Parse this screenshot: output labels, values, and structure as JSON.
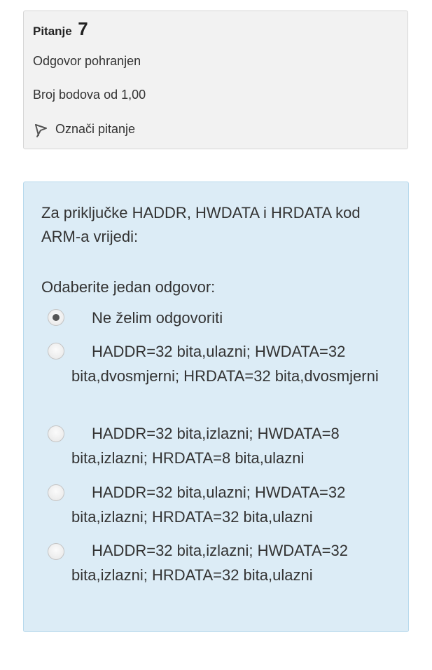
{
  "info": {
    "question_label": "Pitanje",
    "question_number": "7",
    "state": "Odgovor pohranjen",
    "grade": "Broj bodova od 1,00",
    "flag_label": "Označi pitanje"
  },
  "question": {
    "text": "Za priključke HADDR, HWDATA i HRDATA kod ARM-a vrijedi:",
    "prompt": "Odaberite jedan odgovor:",
    "options": [
      {
        "label": "Ne želim odgovoriti",
        "selected": true
      },
      {
        "label": "HADDR=32 bita,ulazni;  HWDATA=32 bita,dvosmjerni;  HRDATA=32 bita,dvosmjerni",
        "selected": false
      },
      {
        "label": "HADDR=32 bita,izlazni;  HWDATA=8 bita,izlazni;  HRDATA=8 bita,ulazni",
        "selected": false
      },
      {
        "label": "HADDR=32 bita,ulazni;  HWDATA=32 bita,izlazni;  HRDATA=32 bita,ulazni",
        "selected": false
      },
      {
        "label": "HADDR=32 bita,izlazni;  HWDATA=32 bita,izlazni;  HRDATA=32 bita,ulazni",
        "selected": false
      }
    ]
  },
  "colors": {
    "info_bg": "#f2f2f2",
    "question_bg": "#dcecf6",
    "radio_selected_dot": "#555555"
  }
}
